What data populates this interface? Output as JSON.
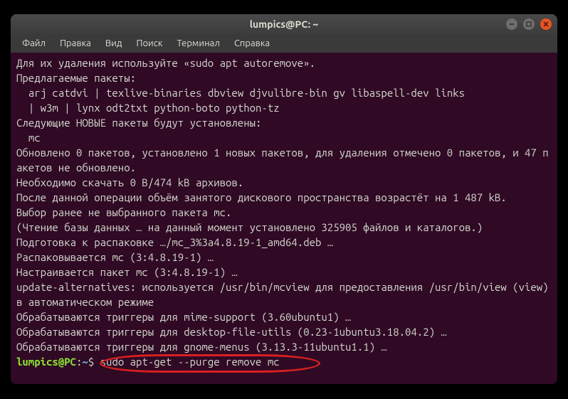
{
  "window": {
    "title": "lumpics@PC: ~"
  },
  "menubar": {
    "items": [
      "Файл",
      "Правка",
      "Вид",
      "Поиск",
      "Терминал",
      "Справка"
    ]
  },
  "terminal": {
    "lines": [
      "Для их удаления используйте «sudo apt autoremove».",
      "Предлагаемые пакеты:",
      "  arj catdvi | texlive-binaries dbview djvulibre-bin gv libaspell-dev links",
      "  | w3m | lynx odt2txt python-boto python-tz",
      "Следующие НОВЫЕ пакеты будут установлены:",
      "  mc",
      "Обновлено 0 пакетов, установлено 1 новых пакетов, для удаления отмечено 0 пакетов, и 47 пакетов не обновлено.",
      "Необходимо скачать 0 B/474 kB архивов.",
      "После данной операции объём занятого дискового пространства возрастёт на 1 487 kB.",
      "Выбор ранее не выбранного пакета mc.",
      "(Чтение базы данных … на данный момент установлено 325905 файлов и каталогов.)",
      "Подготовка к распаковке …/mc_3%3a4.8.19-1_amd64.deb …",
      "Распаковывается mc (3:4.8.19-1) …",
      "Настраивается пакет mc (3:4.8.19-1) …",
      "update-alternatives: используется /usr/bin/mcview для предоставления /usr/bin/view (view) в автоматическом режиме",
      "Обрабатываются триггеры для mime-support (3.60ubuntu1) …",
      "Обрабатываются триггеры для desktop-file-utils (0.23-1ubuntu3.18.04.2) …",
      "Обрабатываются триггеры для gnome-menus (3.13.3-11ubuntu1.1) …"
    ],
    "prompt": {
      "user_host": "lumpics@PC",
      "separator": ":",
      "path": "~",
      "dollar": "$",
      "command": "sudo apt-get --purge remove mc"
    }
  }
}
